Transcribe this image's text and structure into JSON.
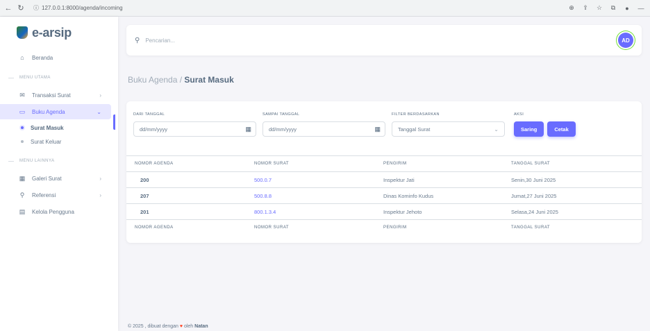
{
  "browser": {
    "url": "127.0.0.1:8000/agenda/incoming"
  },
  "sidebar": {
    "brand": "e-arsip",
    "dashboard": "Beranda",
    "header_main": "Menu Utama",
    "items_main": [
      {
        "label": "Transaksi Surat"
      },
      {
        "label": "Buku Agenda"
      }
    ],
    "sub_items": [
      {
        "label": "Surat Masuk"
      },
      {
        "label": "Surat Keluar"
      }
    ],
    "header_other": "Menu Lainnya",
    "items_other": [
      {
        "label": "Galeri Surat"
      },
      {
        "label": "Referensi"
      },
      {
        "label": "Kelola Pengguna"
      }
    ]
  },
  "navbar": {
    "search_placeholder": "Pencarian...",
    "avatar_initials": "AD"
  },
  "breadcrumb": {
    "parent": "Buku Agenda /",
    "current": "Surat Masuk"
  },
  "filters": {
    "from_label": "Dari Tanggal",
    "from_placeholder": "dd/mm/yyyy",
    "to_label": "Sampai Tanggal",
    "to_placeholder": "dd/mm/yyyy",
    "filter_by_label": "Filter Berdasarkan",
    "filter_by_value": "Tanggal Surat",
    "action_label": "Aksi",
    "filter_button": "Saring",
    "print_button": "Cetak"
  },
  "table": {
    "headers": [
      "Nomor Agenda",
      "Nomor Surat",
      "Pengirim",
      "Tanggal Surat"
    ],
    "rows": [
      {
        "agenda": "200",
        "surat": "500.0.7",
        "pengirim": "Inspektur Jati",
        "tanggal": "Senin,30 Juni 2025"
      },
      {
        "agenda": "207",
        "surat": "500.8.8",
        "pengirim": "Dinas Kominfo Kudus",
        "tanggal": "Jumat,27 Juni 2025"
      },
      {
        "agenda": "201",
        "surat": "800.1.3.4",
        "pengirim": "Inspektur Jehoto",
        "tanggal": "Selasa,24 Juni 2025"
      }
    ]
  },
  "footer": {
    "prefix": "© 2025 , dibuat dengan",
    "suffix": "oleh",
    "brand": "Natan"
  }
}
